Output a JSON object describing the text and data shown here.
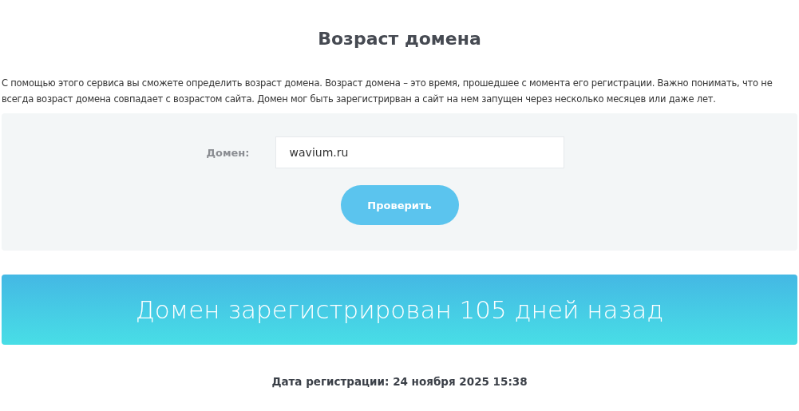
{
  "title": "Возраст домена",
  "description": "С помощью этого сервиса вы сможете определить возраст домена. Возраст домена – это время, прошедшее с момента его регистрации. Важно понимать, что не всегда возраст домена совпадает с возрастом сайта. Домен мог быть зарегистрирван а сайт на нем запущен через несколько месяцев или даже лет.",
  "form": {
    "label": "Домен:",
    "value": "wavium.ru",
    "button": "Проверить"
  },
  "result": "Домен зарегистрирован 105 дней назад",
  "registration_date": "Дата регистрации: 24 ноября 2025 15:38"
}
